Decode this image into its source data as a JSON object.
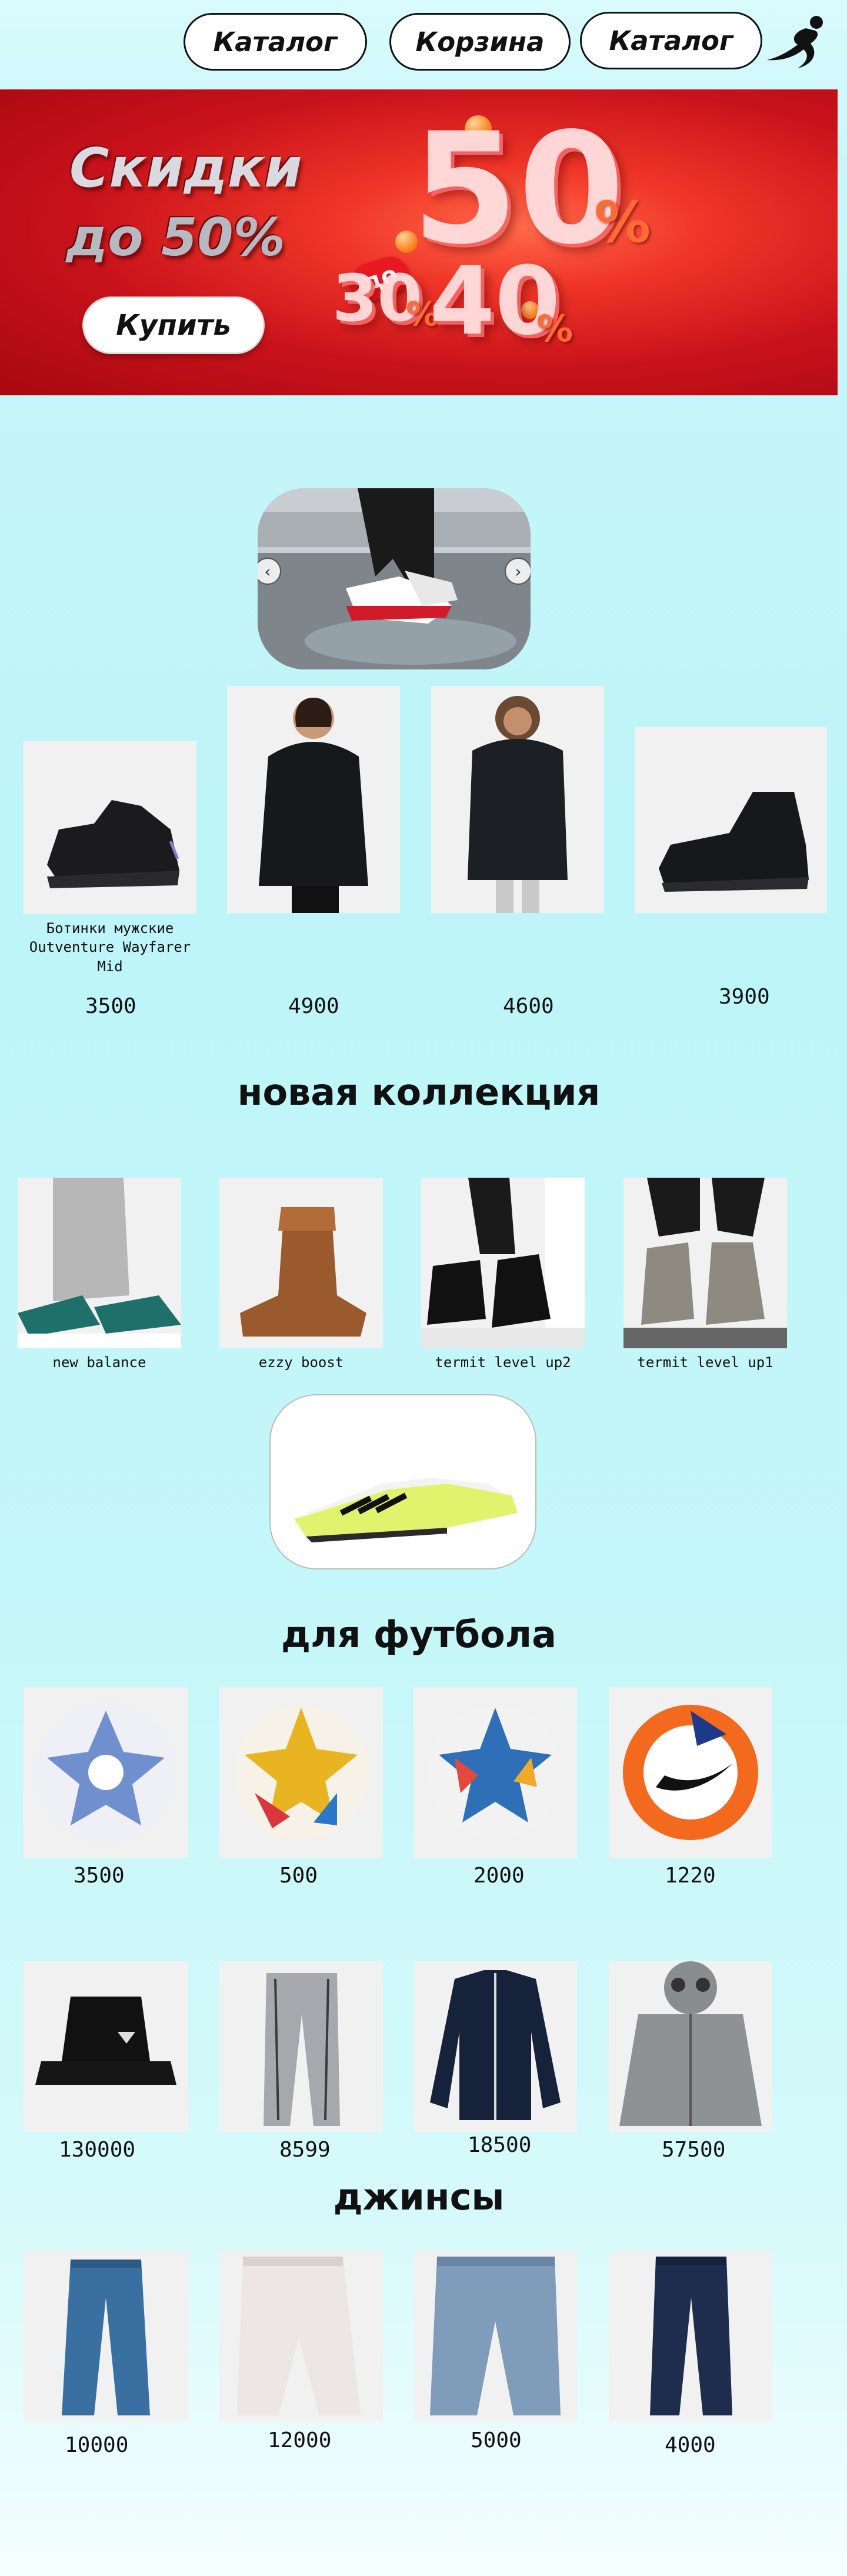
{
  "header": {
    "nav": [
      "Каталог",
      "Корзина",
      "Каталог"
    ],
    "logo_icon": "runner-logo-icon"
  },
  "banner": {
    "title": "Скидки",
    "subtitle": "до 50%",
    "buy_label": "Купить",
    "tag": "до",
    "numbers": [
      "50",
      "30",
      "40"
    ],
    "percent": "%"
  },
  "slider": {
    "prev_icon": "chevron-left-icon",
    "next_icon": "chevron-right-icon"
  },
  "top_products": [
    {
      "name": "Ботинки мужские Outventure Wayfarer Mid",
      "price": "3500"
    },
    {
      "name": "",
      "price": "4900"
    },
    {
      "name": "",
      "price": "4600"
    },
    {
      "name": "",
      "price": "3900"
    }
  ],
  "new_collection": {
    "title": "новая коллекция",
    "items": [
      {
        "name": "new balance"
      },
      {
        "name": "ezzy boost"
      },
      {
        "name": "termit level up2"
      },
      {
        "name": "termit level up1"
      }
    ]
  },
  "football": {
    "title": "для футбола",
    "items": [
      {
        "price": "3500"
      },
      {
        "price": "500"
      },
      {
        "price": "2000"
      },
      {
        "price": "1220"
      }
    ]
  },
  "clothes": {
    "items": [
      {
        "price": "130000"
      },
      {
        "price": "8599"
      },
      {
        "price": "18500"
      },
      {
        "price": "57500"
      }
    ]
  },
  "jeans": {
    "title": "джинсы",
    "items": [
      {
        "price": "10000"
      },
      {
        "price": "12000"
      },
      {
        "price": "5000"
      },
      {
        "price": "4000"
      }
    ]
  }
}
